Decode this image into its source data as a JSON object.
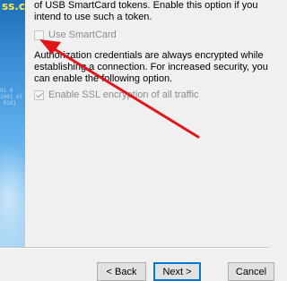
{
  "banner": {
    "watermark": "ss.cl",
    "digits": "01 0\n1001 01\n 0101"
  },
  "smartcard": {
    "description": "of USB SmartCard tokens. Enable this option if you intend to use such a token.",
    "checkbox_label": "Use SmartCard",
    "checked": false,
    "enabled": false
  },
  "ssl": {
    "description": "Authorization credentials are always encrypted while establishing a connection. For increased security, you can enable the following option.",
    "checkbox_label": "Enable SSL encryption of all traffic",
    "checked": true,
    "enabled": false
  },
  "buttons": {
    "back": "< Back",
    "next": "Next >",
    "cancel": "Cancel"
  },
  "colors": {
    "annotation_arrow": "#e0161b",
    "banner_blue": "#3a8fd6",
    "default_button_border": "#0078d7"
  },
  "icons": [
    "annotation-arrow"
  ]
}
